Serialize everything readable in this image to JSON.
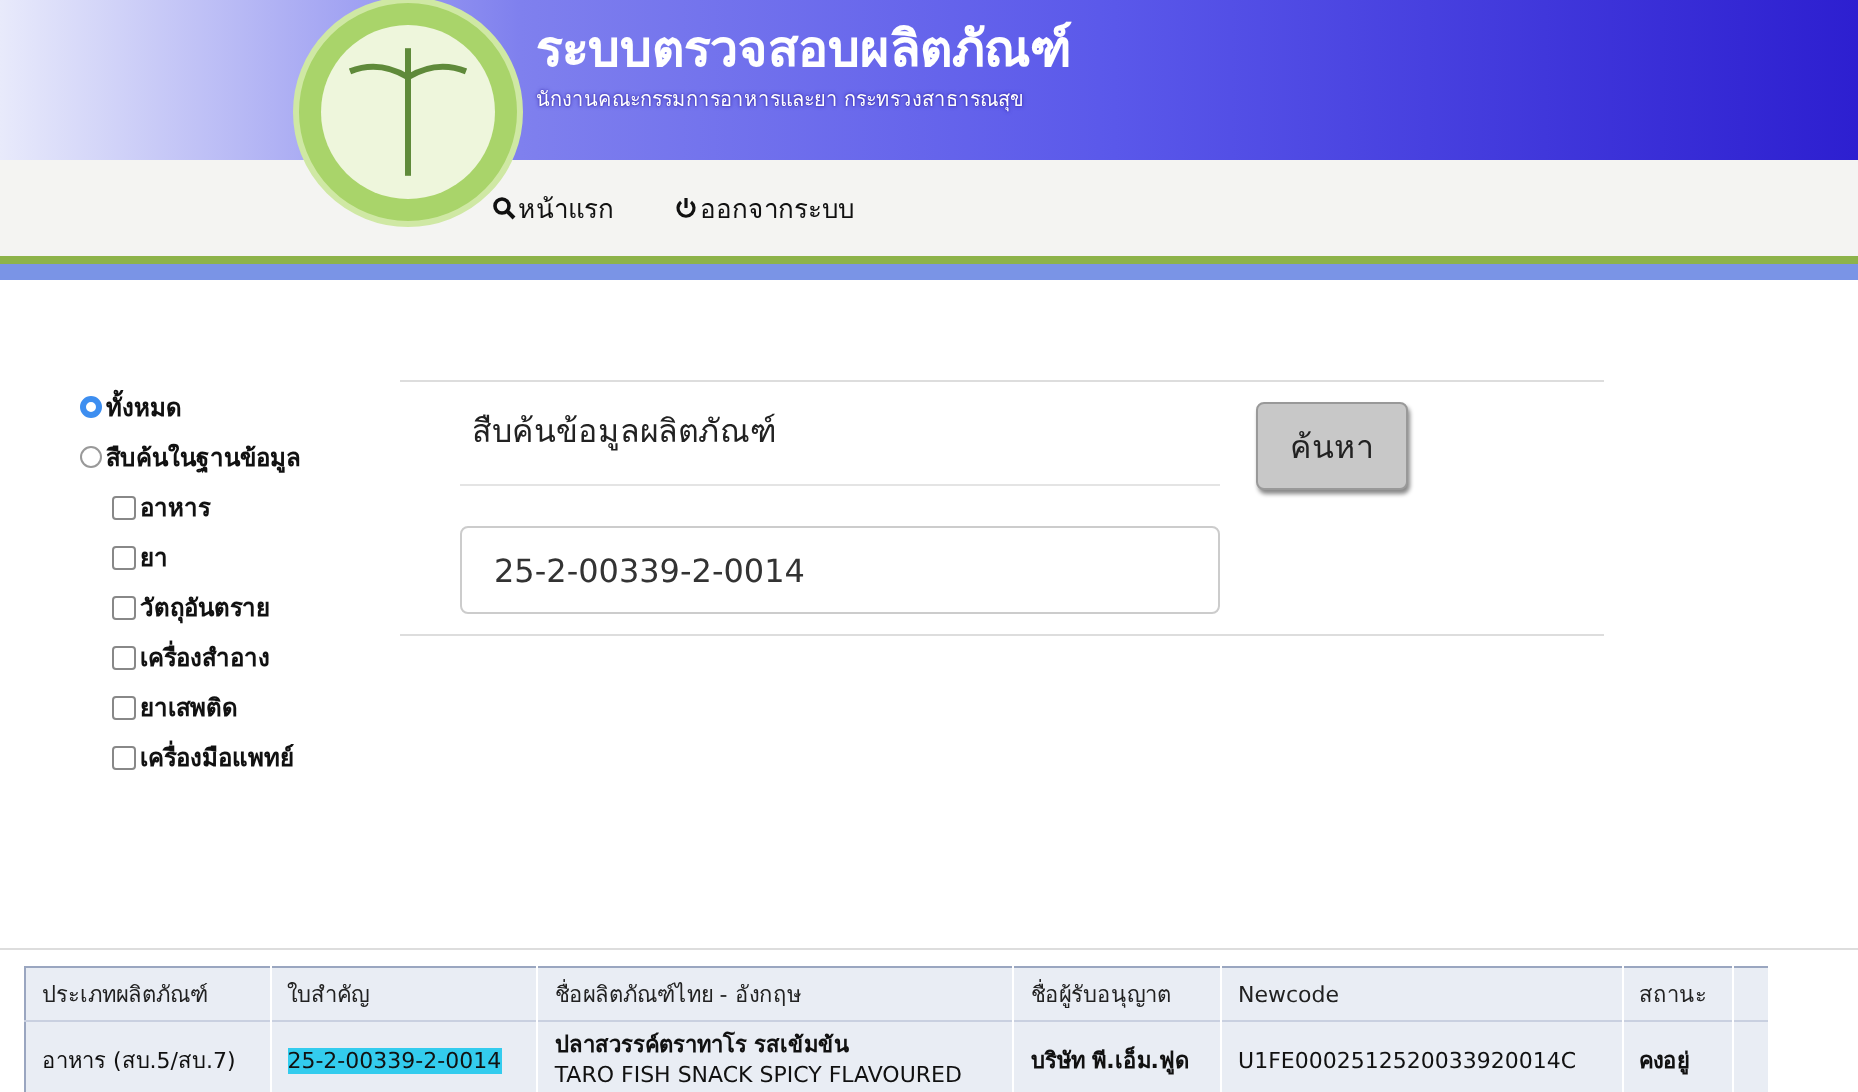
{
  "header": {
    "title": "ระบบตรวจสอบผลิตภัณฑ์",
    "subtitle": "นักงานคณะกรรมการอาหารและยา กระทรวงสาธารณสุข"
  },
  "nav": [
    {
      "kind": "home",
      "label": "หน้าแรก"
    },
    {
      "kind": "logout",
      "label": "ออกจากระบบ"
    }
  ],
  "scope": [
    {
      "label": "ทั้งหมด",
      "selected": true
    },
    {
      "label": "สืบค้นในฐานข้อมูล",
      "selected": false
    }
  ],
  "categories": [
    {
      "label": "อาหาร",
      "checked": false
    },
    {
      "label": "ยา",
      "checked": false
    },
    {
      "label": "วัตถุอันตราย",
      "checked": false
    },
    {
      "label": "เครื่องสำอาง",
      "checked": false
    },
    {
      "label": "ยาเสพติด",
      "checked": false
    },
    {
      "label": "เครื่องมือแพทย์",
      "checked": false
    }
  ],
  "search": {
    "heading": "สืบค้นข้อมูลผลิตภัณฑ์",
    "value": "25-2-00339-2-0014",
    "button": "ค้นหา"
  },
  "table": {
    "columns": [
      "ประเภทผลิตภัณฑ์",
      "ใบสำคัญ",
      "ชื่อผลิตภัณฑ์ไทย - อังกฤษ",
      "ชื่อผู้รับอนุญาต",
      "Newcode",
      "สถานะ"
    ],
    "rows": [
      {
        "cells": [
          {
            "lines": [
              "อาหาร (สบ.5/สบ.7)"
            ],
            "highlighted": false
          },
          {
            "lines": [
              "25-2-00339-2-0014"
            ],
            "highlighted": true
          },
          {
            "lines": [
              "ปลาสวรรค์ตราทาโร รสเข้มข้น",
              "TARO FISH SNACK SPICY FLAVOURED"
            ],
            "highlighted": false
          },
          {
            "lines": [
              "บริษัท พี.เอ็ม.ฟูด"
            ],
            "highlighted": false
          },
          {
            "lines": [
              "U1FE0002512520033920014C"
            ],
            "highlighted": false
          },
          {
            "lines": [
              "คงอยู่"
            ],
            "highlighted": false
          }
        ]
      }
    ]
  }
}
